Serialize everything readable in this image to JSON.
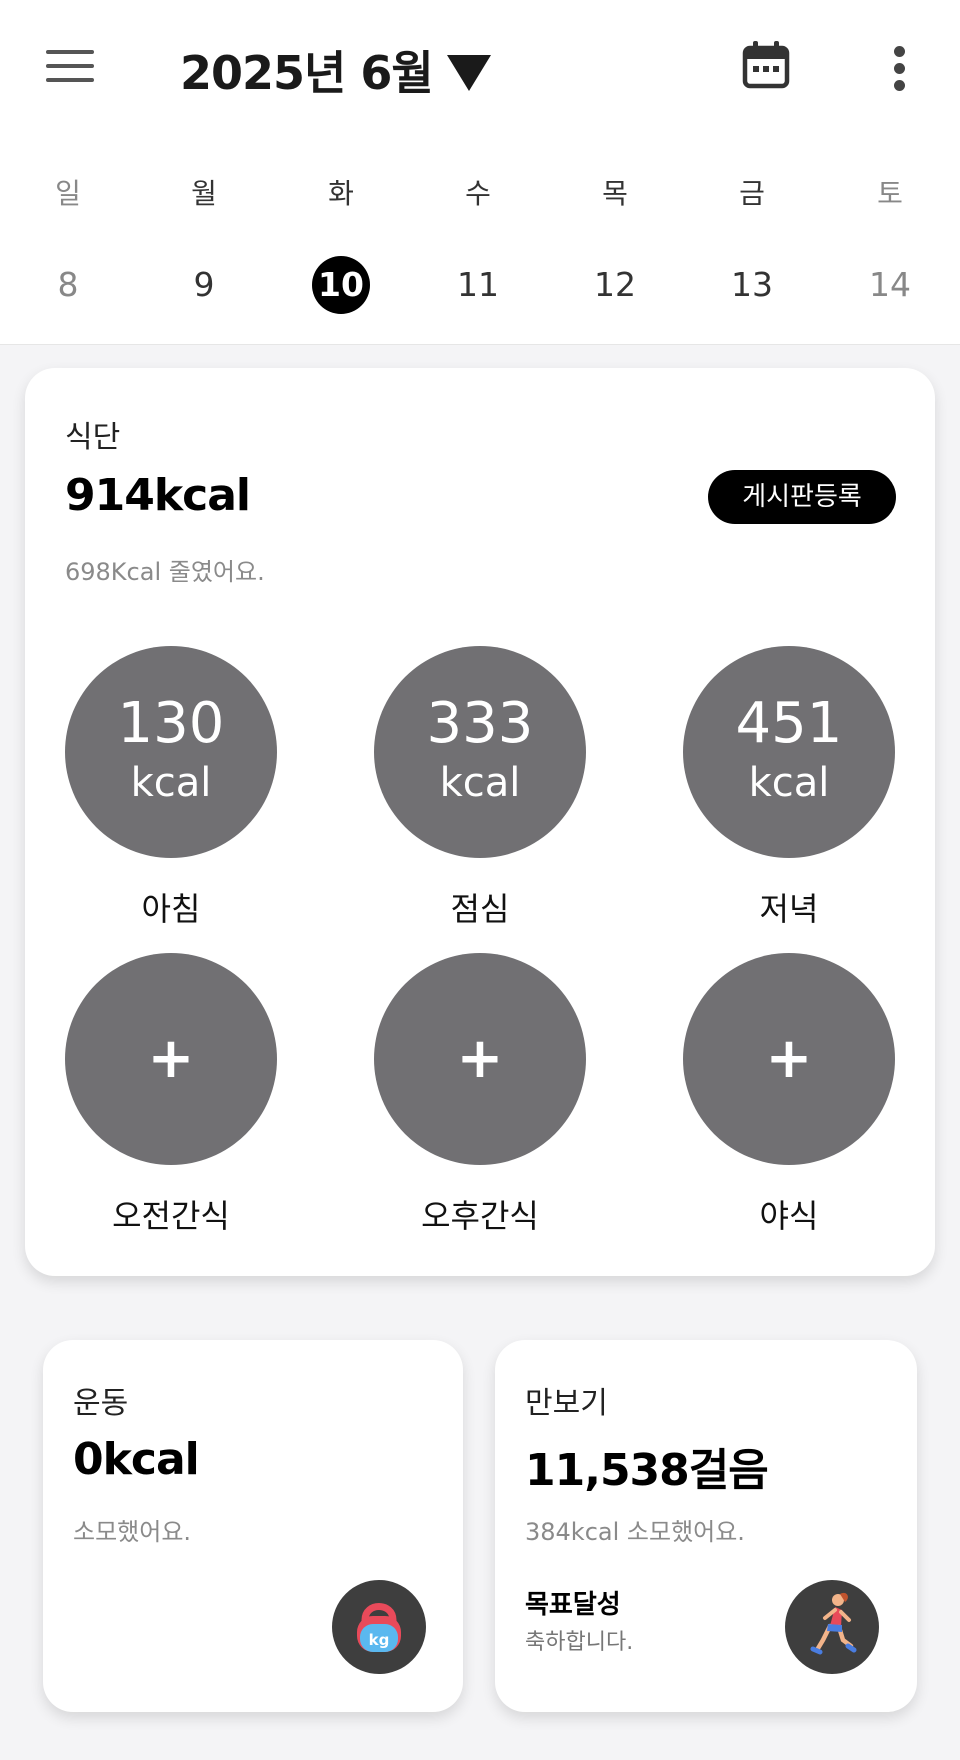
{
  "header": {
    "title": "2025년 6월",
    "icons": {
      "menu": "hamburger-menu-icon",
      "dropdown": "triangle-down-icon",
      "calendar": "calendar-icon",
      "more": "more-vertical-icon"
    }
  },
  "week": {
    "days": [
      {
        "name": "일",
        "date": "8",
        "weekend": true,
        "selected": false
      },
      {
        "name": "월",
        "date": "9",
        "weekend": false,
        "selected": false
      },
      {
        "name": "화",
        "date": "10",
        "weekend": false,
        "selected": true
      },
      {
        "name": "수",
        "date": "11",
        "weekend": false,
        "selected": false
      },
      {
        "name": "목",
        "date": "12",
        "weekend": false,
        "selected": false
      },
      {
        "name": "금",
        "date": "13",
        "weekend": false,
        "selected": false
      },
      {
        "name": "토",
        "date": "14",
        "weekend": true,
        "selected": false
      }
    ]
  },
  "diet": {
    "label": "식단",
    "total": "914kcal",
    "post_button": "게시판등록",
    "sub": "698Kcal 줄였어요.",
    "meals": [
      {
        "name": "아침",
        "kcal": "130",
        "unit": "kcal"
      },
      {
        "name": "점심",
        "kcal": "333",
        "unit": "kcal"
      },
      {
        "name": "저녁",
        "kcal": "451",
        "unit": "kcal"
      }
    ],
    "snacks": [
      {
        "name": "오전간식",
        "symbol": "+"
      },
      {
        "name": "오후간식",
        "symbol": "+"
      },
      {
        "name": "야식",
        "symbol": "+"
      }
    ]
  },
  "exercise": {
    "label": "운동",
    "value": "0kcal",
    "sub": "소모했어요.",
    "icon": "kettlebell-kg-icon"
  },
  "steps": {
    "label": "만보기",
    "value": "11,538걸음",
    "sub": "384kcal 소모했어요.",
    "goal_title": "목표달성",
    "goal_sub": "축하합니다.",
    "icon": "running-woman-icon"
  },
  "colors": {
    "background": "#f4f4f6",
    "card": "#ffffff",
    "meal_circle": "#717073",
    "selected_day": "#000000",
    "badge": "#3e3e3e"
  }
}
